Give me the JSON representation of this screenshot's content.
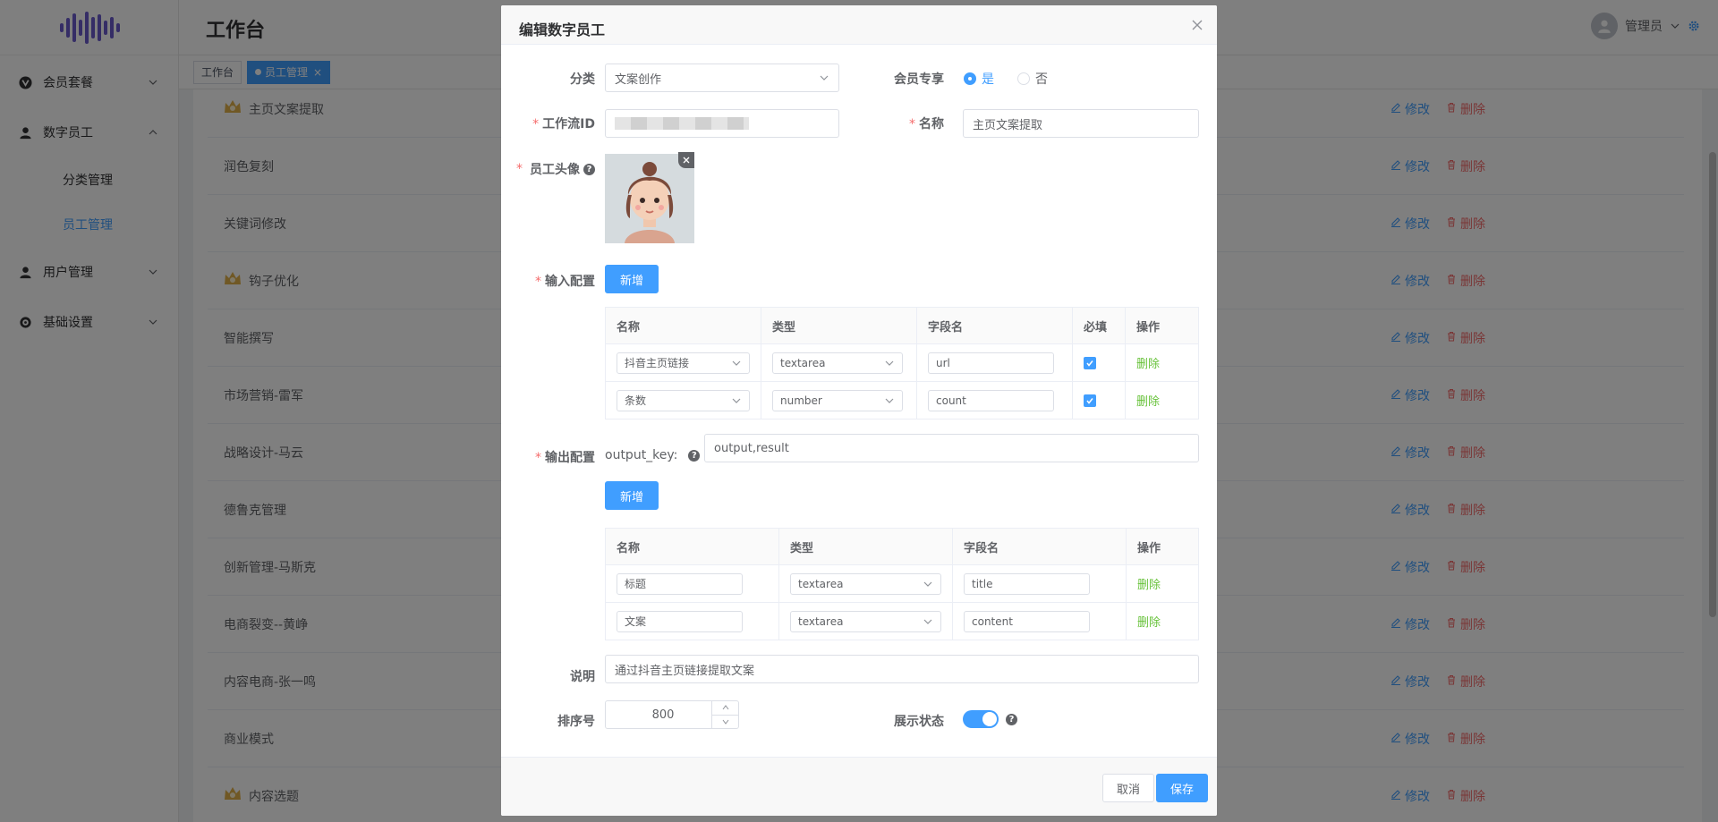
{
  "app": {
    "page_title": "工作台",
    "user_name": "管理员"
  },
  "sidebar": {
    "items": [
      {
        "label": "会员套餐",
        "icon": "vip-icon"
      },
      {
        "label": "数字员工",
        "icon": "person-icon"
      },
      {
        "label": "用户管理",
        "icon": "user-icon"
      },
      {
        "label": "基础设置",
        "icon": "gear-icon"
      }
    ],
    "subitems": [
      {
        "label": "分类管理"
      },
      {
        "label": "员工管理"
      }
    ]
  },
  "tags": {
    "home": "工作台",
    "active": "员工管理"
  },
  "list": {
    "edit_label": "修改",
    "delete_label": "删除",
    "rows": [
      {
        "name": "主页文案提取",
        "crown": true
      },
      {
        "name": "润色复刻",
        "crown": false
      },
      {
        "name": "关键词修改",
        "crown": false
      },
      {
        "name": "钩子优化",
        "crown": true
      },
      {
        "name": "智能撰写",
        "crown": false
      },
      {
        "name": "市场营销-雷军",
        "crown": false
      },
      {
        "name": "战略设计-马云",
        "crown": false
      },
      {
        "name": "德鲁克管理",
        "crown": false
      },
      {
        "name": "创新管理-马斯克",
        "crown": false
      },
      {
        "name": "电商裂变--黄峥",
        "crown": false
      },
      {
        "name": "内容电商-张一鸣",
        "crown": false
      },
      {
        "name": "商业模式",
        "crown": false
      },
      {
        "name": "内容选题",
        "crown": true
      }
    ]
  },
  "dialog": {
    "title": "编辑数字员工",
    "category_label": "分类",
    "category_value": "文案创作",
    "member_label": "会员专享",
    "member_yes": "是",
    "member_no": "否",
    "workflow_label": "工作流ID",
    "name_label": "名称",
    "name_value": "主页文案提取",
    "avatar_label": "员工头像",
    "input_config_label": "输入配置",
    "add_label": "新增",
    "input_table": {
      "headers": [
        "名称",
        "类型",
        "字段名",
        "必填",
        "操作"
      ],
      "rows": [
        {
          "name": "抖音主页链接",
          "type": "textarea",
          "field": "url"
        },
        {
          "name": "条数",
          "type": "number",
          "field": "count"
        }
      ],
      "delete_label": "删除"
    },
    "output_config_label": "输出配置",
    "output_key_label": "output_key:",
    "output_key_value": "output,result",
    "output_table": {
      "headers": [
        "名称",
        "类型",
        "字段名",
        "操作"
      ],
      "rows": [
        {
          "name": "标题",
          "type": "textarea",
          "field": "title"
        },
        {
          "name": "文案",
          "type": "textarea",
          "field": "content"
        }
      ],
      "delete_label": "删除"
    },
    "desc_label": "说明",
    "desc_value": "通过抖音主页链接提取文案",
    "sort_label": "排序号",
    "sort_value": "800",
    "display_label": "展示状态",
    "cancel_label": "取消",
    "save_label": "保存"
  },
  "colors": {
    "primary": "#409eff",
    "danger": "#f56c6c",
    "success": "#67c23a"
  }
}
